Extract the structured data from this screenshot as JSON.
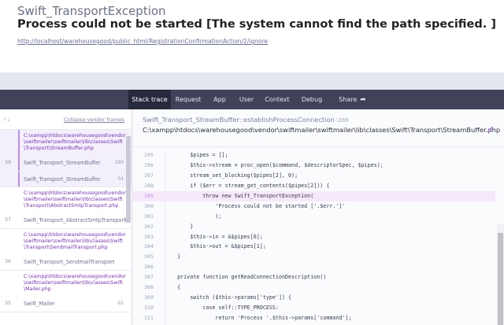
{
  "header": {
    "exception_class": "Swift_TransportException",
    "message": "Process could not be started [The system cannot find the path specified. ]",
    "url": "http://localhost/warehousegood/public_html/RegistrationConfirmationAction/2/ignore"
  },
  "tabs": [
    {
      "label": "Stack trace",
      "active": true
    },
    {
      "label": "Request"
    },
    {
      "label": "App"
    },
    {
      "label": "User"
    },
    {
      "label": "Context"
    },
    {
      "label": "Debug"
    },
    {
      "label": "Share",
      "icon": "share-arrow-icon"
    }
  ],
  "sidebar": {
    "collapse_label": "Collapse vendor frames",
    "groups": [
      {
        "file": "C:\\xampp\\htdocs\\warehousegood\\vendor\\swiftmailer\\swiftmailer\\lib\\classes\\Swift\\Transport\\StreamBuffer.php",
        "selected": true,
        "frames": [
          {
            "num": "58",
            "name": "Swift_Transport_StreamBuffer",
            "line": "289"
          },
          {
            "num": "",
            "name": "Swift_Transport_StreamBuffer",
            "line": "54"
          }
        ]
      },
      {
        "file": "C:\\xampp\\htdocs\\warehousegood\\vendor\\swiftmailer\\swiftmailer\\lib\\classes\\Swift\\Transport\\AbstractSmtpTransport.php",
        "frames": [
          {
            "num": "57",
            "name": "Swift_Transport_AbstractSmtpTransport",
            "line": "14"
          }
        ]
      },
      {
        "file": "C:\\xampp\\htdocs\\warehousegood\\vendor\\swiftmailer\\swiftmailer\\lib\\classes\\Swift\\Transport\\SendmailTransport.php",
        "frames": [
          {
            "num": "56",
            "name": "Swift_Transport_SendmailTransport",
            "line": ""
          }
        ]
      },
      {
        "file": "C:\\xampp\\htdocs\\warehousegood\\vendor\\swiftmailer\\swiftmailer\\lib\\classes\\Swift\\Mailer.php",
        "frames": [
          {
            "num": "55",
            "name": "Swift_Mailer",
            "line": "65"
          }
        ]
      }
    ]
  },
  "main": {
    "class_method": "Swift_Transport_StreamBuffer::establishProcessConnection",
    "line": ":289",
    "path": "C:\\xampp\\htdocs\\warehousegood\\vendor\\swiftmailer\\swiftmailer\\lib\\classes\\Swift\\Transport\\StreamBuffer.php",
    "code": [
      {
        "n": "295",
        "t": "        $pipes = [];"
      },
      {
        "n": "296",
        "t": "        $this->stream = proc_open($command, $descriptorSpec, $pipes);"
      },
      {
        "n": "297",
        "t": "        stream_set_blocking($pipes[2], 0);"
      },
      {
        "n": "298",
        "t": "        if ($err = stream_get_contents($pipes[2])) {"
      },
      {
        "n": "299",
        "t": "            throw new Swift_TransportException(",
        "hl": true
      },
      {
        "n": "300",
        "t": "                'Process could not be started ['.$err.']'"
      },
      {
        "n": "301",
        "t": "                );"
      },
      {
        "n": "302",
        "t": "        }"
      },
      {
        "n": "303",
        "t": "        $this->in = &$pipes[0];"
      },
      {
        "n": "304",
        "t": "        $this->out = &$pipes[1];"
      },
      {
        "n": "305",
        "t": "    }"
      },
      {
        "n": "306",
        "t": ""
      },
      {
        "n": "307",
        "t": "    private function getReadConnectionDescription()"
      },
      {
        "n": "308",
        "t": "    {"
      },
      {
        "n": "309",
        "t": "        switch ($this->params['type']) {"
      },
      {
        "n": "310",
        "t": "            case self::TYPE_PROCESS:"
      },
      {
        "n": "311",
        "t": "                return 'Process '.$this->params['command'];"
      }
    ]
  }
}
